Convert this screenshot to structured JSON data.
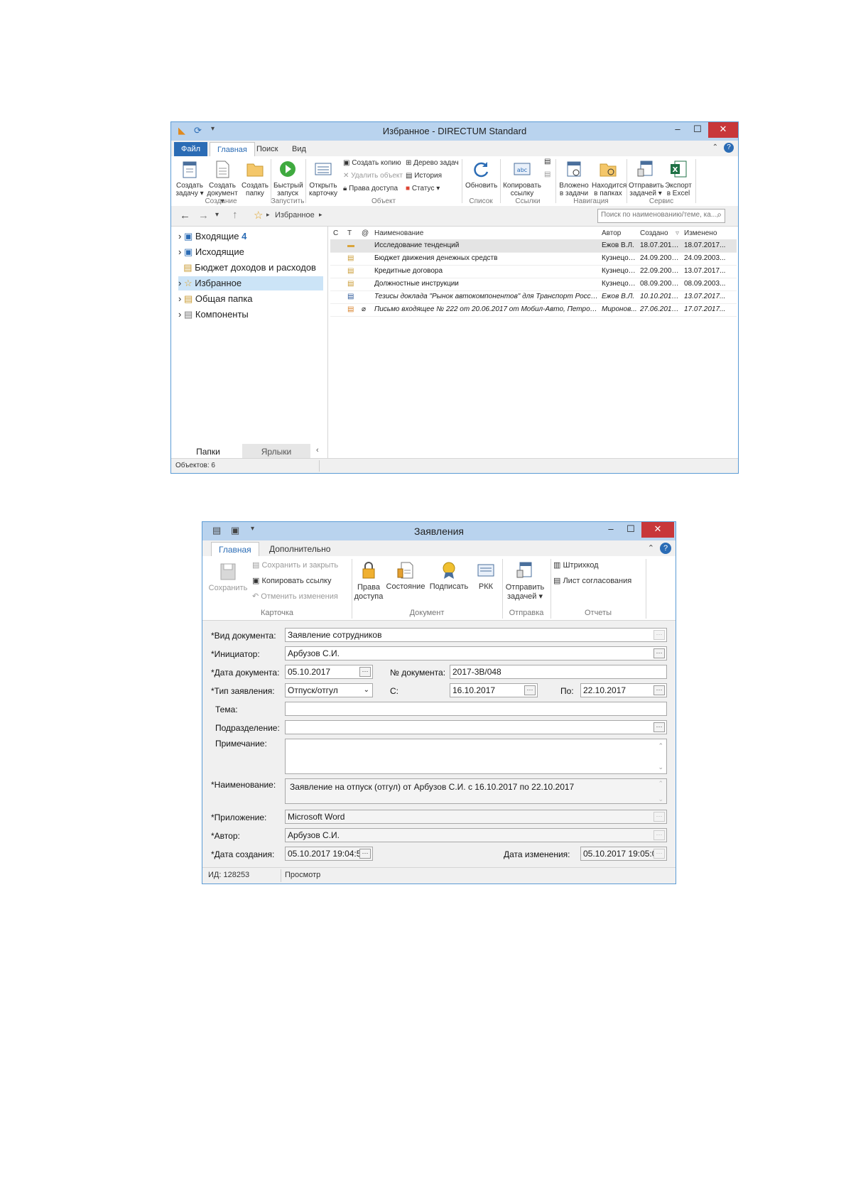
{
  "win1": {
    "title": "Избранное - DIRECTUM Standard",
    "tabs": [
      "Файл",
      "Главная",
      "Поиск",
      "Вид"
    ],
    "ribbon": {
      "create_task": "Создать задачу ▾",
      "create_doc": "Создать документ ▾",
      "create_folder": "Создать папку",
      "quick_launch": "Быстрый запуск",
      "open_card": "Открыть карточку",
      "copy_obj": "Создать копию",
      "delete_obj": "Удалить объект",
      "access": "Права доступа",
      "task_tree": "Дерево задач",
      "history": "История",
      "state": "Статус ▾",
      "refresh": "Обновить",
      "copy_link": "Копировать ссылку",
      "nested": "Вложено в задачи",
      "located": "Находится в папках",
      "send_tasks": "Отправить задачей ▾",
      "export_excel": "Экспорт в Excel",
      "groups": [
        "Создание",
        "Запустить",
        "Объект",
        "Список",
        "Ссылки",
        "Навигация",
        "Сервис"
      ]
    },
    "breadcrumb": "Избранное",
    "search_placeholder": "Поиск по наименованию/теме, ка...",
    "tree": [
      {
        "label": "Входящие",
        "badge": "4"
      },
      {
        "label": "Исходящие"
      },
      {
        "label": "Бюджет доходов и расходов"
      },
      {
        "label": "Избранное"
      },
      {
        "label": "Общая папка"
      },
      {
        "label": "Компоненты"
      }
    ],
    "bottom_tabs": [
      "Папки",
      "Ярлыки"
    ],
    "columns": [
      "С",
      "Т",
      "@",
      "Наименование",
      "Автор",
      "Создано",
      "Изменено"
    ],
    "rows": [
      {
        "name": "Исследование тенденций",
        "author": "Ежов В.Л.",
        "created": "18.07.2017 ...",
        "modified": "18.07.2017..."
      },
      {
        "name": "Бюджет движения денежных средств",
        "author": "Кузнецов...",
        "created": "24.09.2003 ...",
        "modified": "24.09.2003..."
      },
      {
        "name": "Кредитные договора",
        "author": "Кузнецов...",
        "created": "22.09.2003 ...",
        "modified": "13.07.2017..."
      },
      {
        "name": "Должностные инструкции",
        "author": "Кузнецов...",
        "created": "08.09.2003 ...",
        "modified": "08.09.2003..."
      },
      {
        "name": "Тезисы доклада \"Рынок автокомпонентов\" для Транспорт Росси...",
        "author": "Ежов В.Л.",
        "created": "10.10.2016 ...",
        "modified": "13.07.2017..."
      },
      {
        "name": "Письмо входящее № 222 от 20.06.2017 от Мобил-Авто, Петров...",
        "author": "Миронов...",
        "created": "27.06.2016 ...",
        "modified": "17.07.2017..."
      }
    ],
    "status": "Объектов: 6"
  },
  "win2": {
    "title": "Заявления",
    "tabs": [
      "Главная",
      "Дополнительно"
    ],
    "ribbon": {
      "save": "Сохранить",
      "save_close": "Сохранить и закрыть",
      "copy_link": "Копировать ссылку",
      "undo": "Отменить изменения",
      "access": "Права доступа",
      "state": "Состояние",
      "sign": "Подписать",
      "rkk": "РКК",
      "send": "Отправить задачей ▾",
      "barcode": "Штрихкод",
      "approval": "Лист согласования",
      "groups": [
        "Карточка",
        "Документ",
        "Отправка",
        "Отчеты"
      ]
    },
    "form": {
      "doc_kind_label": "*Вид документа:",
      "doc_kind": "Заявление сотрудников",
      "initiator_label": "*Инициатор:",
      "initiator": "Арбузов С.И.",
      "doc_date_label": "*Дата документа:",
      "doc_date": "05.10.2017",
      "doc_no_label": "№ документа:",
      "doc_no": "2017-3B/048",
      "app_type_label": "*Тип заявления:",
      "app_type": "Отпуск/отгул",
      "from_label": "С:",
      "from": "16.10.2017",
      "to_label": "По:",
      "to": "22.10.2017",
      "subject_label": "Тема:",
      "dept_label": "Подразделение:",
      "note_label": "Примечание:",
      "name_label": "*Наименование:",
      "name": "Заявление на отпуск (отгул) от Арбузов С.И. с 16.10.2017 по 22.10.2017",
      "app_label": "*Приложение:",
      "app": "Microsoft Word",
      "author_label": "*Автор:",
      "author": "Арбузов С.И.",
      "created_label": "*Дата создания:",
      "created": "05.10.2017 19:04:58",
      "modified_label": "Дата изменения:",
      "modified": "05.10.2017 19:05:00"
    },
    "status_id": "ИД: 128253",
    "status_mode": "Просмотр"
  }
}
